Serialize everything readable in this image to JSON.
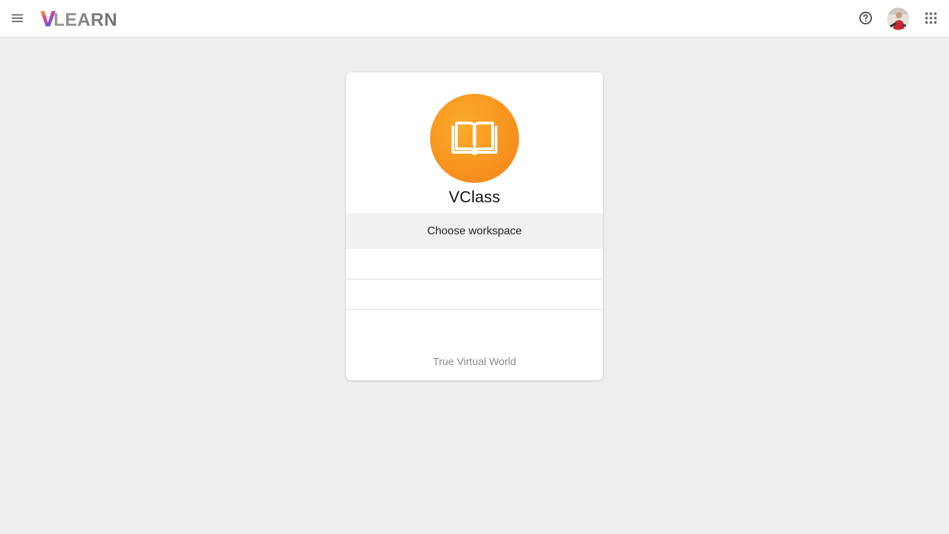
{
  "header": {
    "menu_icon": "hamburger-menu-icon",
    "logo_text": "VLEARN",
    "help_icon": "help-circle-icon",
    "apps_icon": "apps-grid-icon"
  },
  "card": {
    "app_icon": "open-book-icon",
    "app_title": "VClass",
    "choose_label": "Choose workspace",
    "workspaces": [
      "",
      ""
    ],
    "tagline": "True Virtual World"
  },
  "colors": {
    "background": "#eeeeee",
    "accent_orange": "#f7931e",
    "choose_row_bg": "#f1f1f1"
  }
}
